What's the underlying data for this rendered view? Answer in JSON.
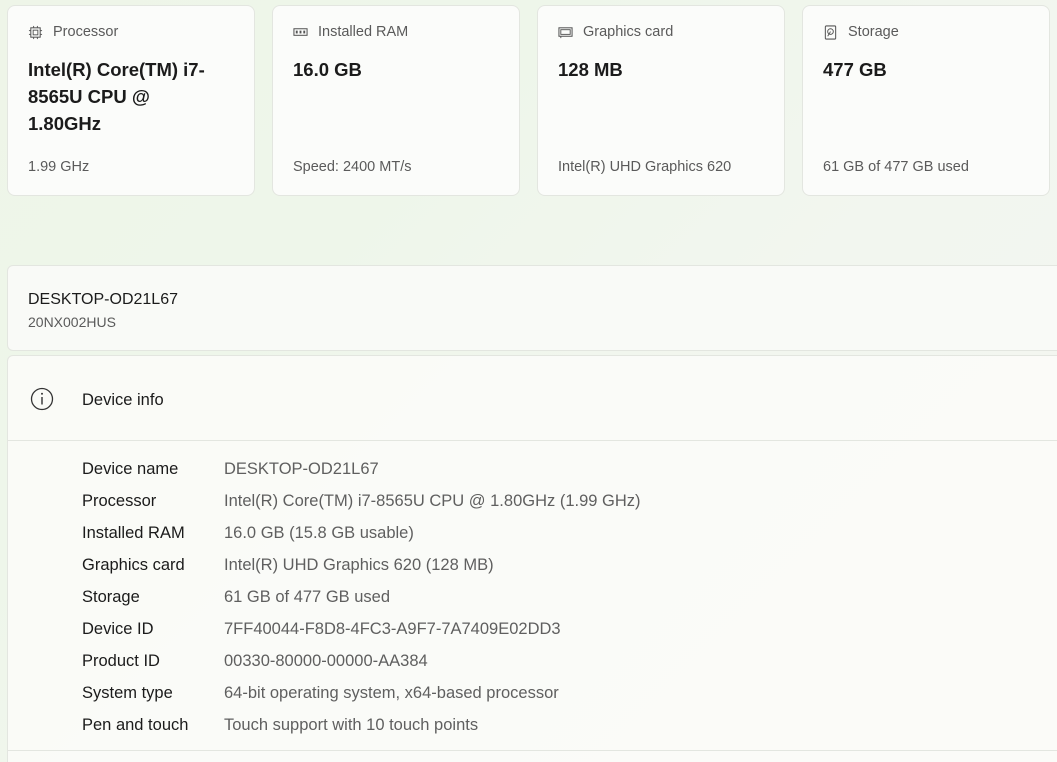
{
  "cards": [
    {
      "title": "Processor",
      "value": "Intel(R) Core(TM) i7-8565U CPU @ 1.80GHz",
      "sub": "1.99 GHz",
      "icon": "processor-icon"
    },
    {
      "title": "Installed RAM",
      "value": "16.0 GB",
      "sub": "Speed: 2400 MT/s",
      "icon": "ram-icon"
    },
    {
      "title": "Graphics card",
      "value": "128 MB",
      "sub": "Intel(R) UHD Graphics 620",
      "icon": "graphics-card-icon"
    },
    {
      "title": "Storage",
      "value": "477 GB",
      "sub": "61 GB of 477 GB used",
      "icon": "storage-icon"
    }
  ],
  "device": {
    "name": "DESKTOP-OD21L67",
    "model": "20NX002HUS"
  },
  "device_info": {
    "title": "Device info",
    "specs": [
      {
        "label": "Device name",
        "value": "DESKTOP-OD21L67"
      },
      {
        "label": "Processor",
        "value": "Intel(R) Core(TM) i7-8565U CPU @ 1.80GHz (1.99 GHz)"
      },
      {
        "label": "Installed RAM",
        "value": "16.0 GB (15.8 GB usable)"
      },
      {
        "label": "Graphics card",
        "value": "Intel(R) UHD Graphics 620 (128 MB)"
      },
      {
        "label": "Storage",
        "value": "61 GB of 477 GB used"
      },
      {
        "label": "Device ID",
        "value": "7FF40044-F8D8-4FC3-A9F7-7A7409E02DD3"
      },
      {
        "label": "Product ID",
        "value": "00330-80000-00000-AA384"
      },
      {
        "label": "System type",
        "value": "64-bit operating system, x64-based processor"
      },
      {
        "label": "Pen and touch",
        "value": "Touch support with 10 touch points"
      }
    ]
  }
}
